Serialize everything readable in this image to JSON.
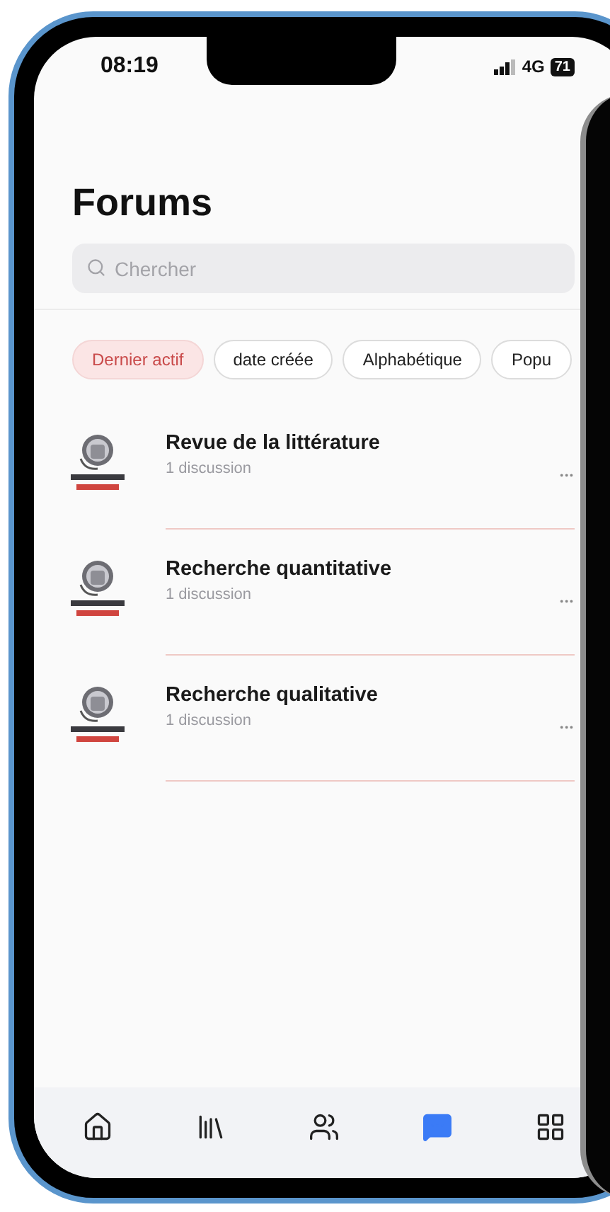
{
  "status_bar": {
    "time": "08:19",
    "network": "4G",
    "battery": "71"
  },
  "title": "Forums",
  "search": {
    "placeholder": "Chercher"
  },
  "sort_chips": [
    {
      "label": "Dernier actif",
      "selected": true
    },
    {
      "label": "date créée",
      "selected": false
    },
    {
      "label": "Alphabétique",
      "selected": false
    },
    {
      "label": "Popu",
      "selected": false
    }
  ],
  "forums": [
    {
      "name": "Revue de la littérature",
      "count": "1 discussion",
      "menu": "•••"
    },
    {
      "name": "Recherche quantitative",
      "count": "1 discussion",
      "menu": "•••"
    },
    {
      "name": "Recherche qualitative",
      "count": "1 discussion",
      "menu": "•••"
    }
  ],
  "tab_bar": [
    {
      "kind": "home",
      "selected": false
    },
    {
      "kind": "library",
      "selected": false
    },
    {
      "kind": "people",
      "selected": false
    },
    {
      "kind": "chat",
      "selected": true
    },
    {
      "kind": "grid",
      "selected": false
    }
  ]
}
